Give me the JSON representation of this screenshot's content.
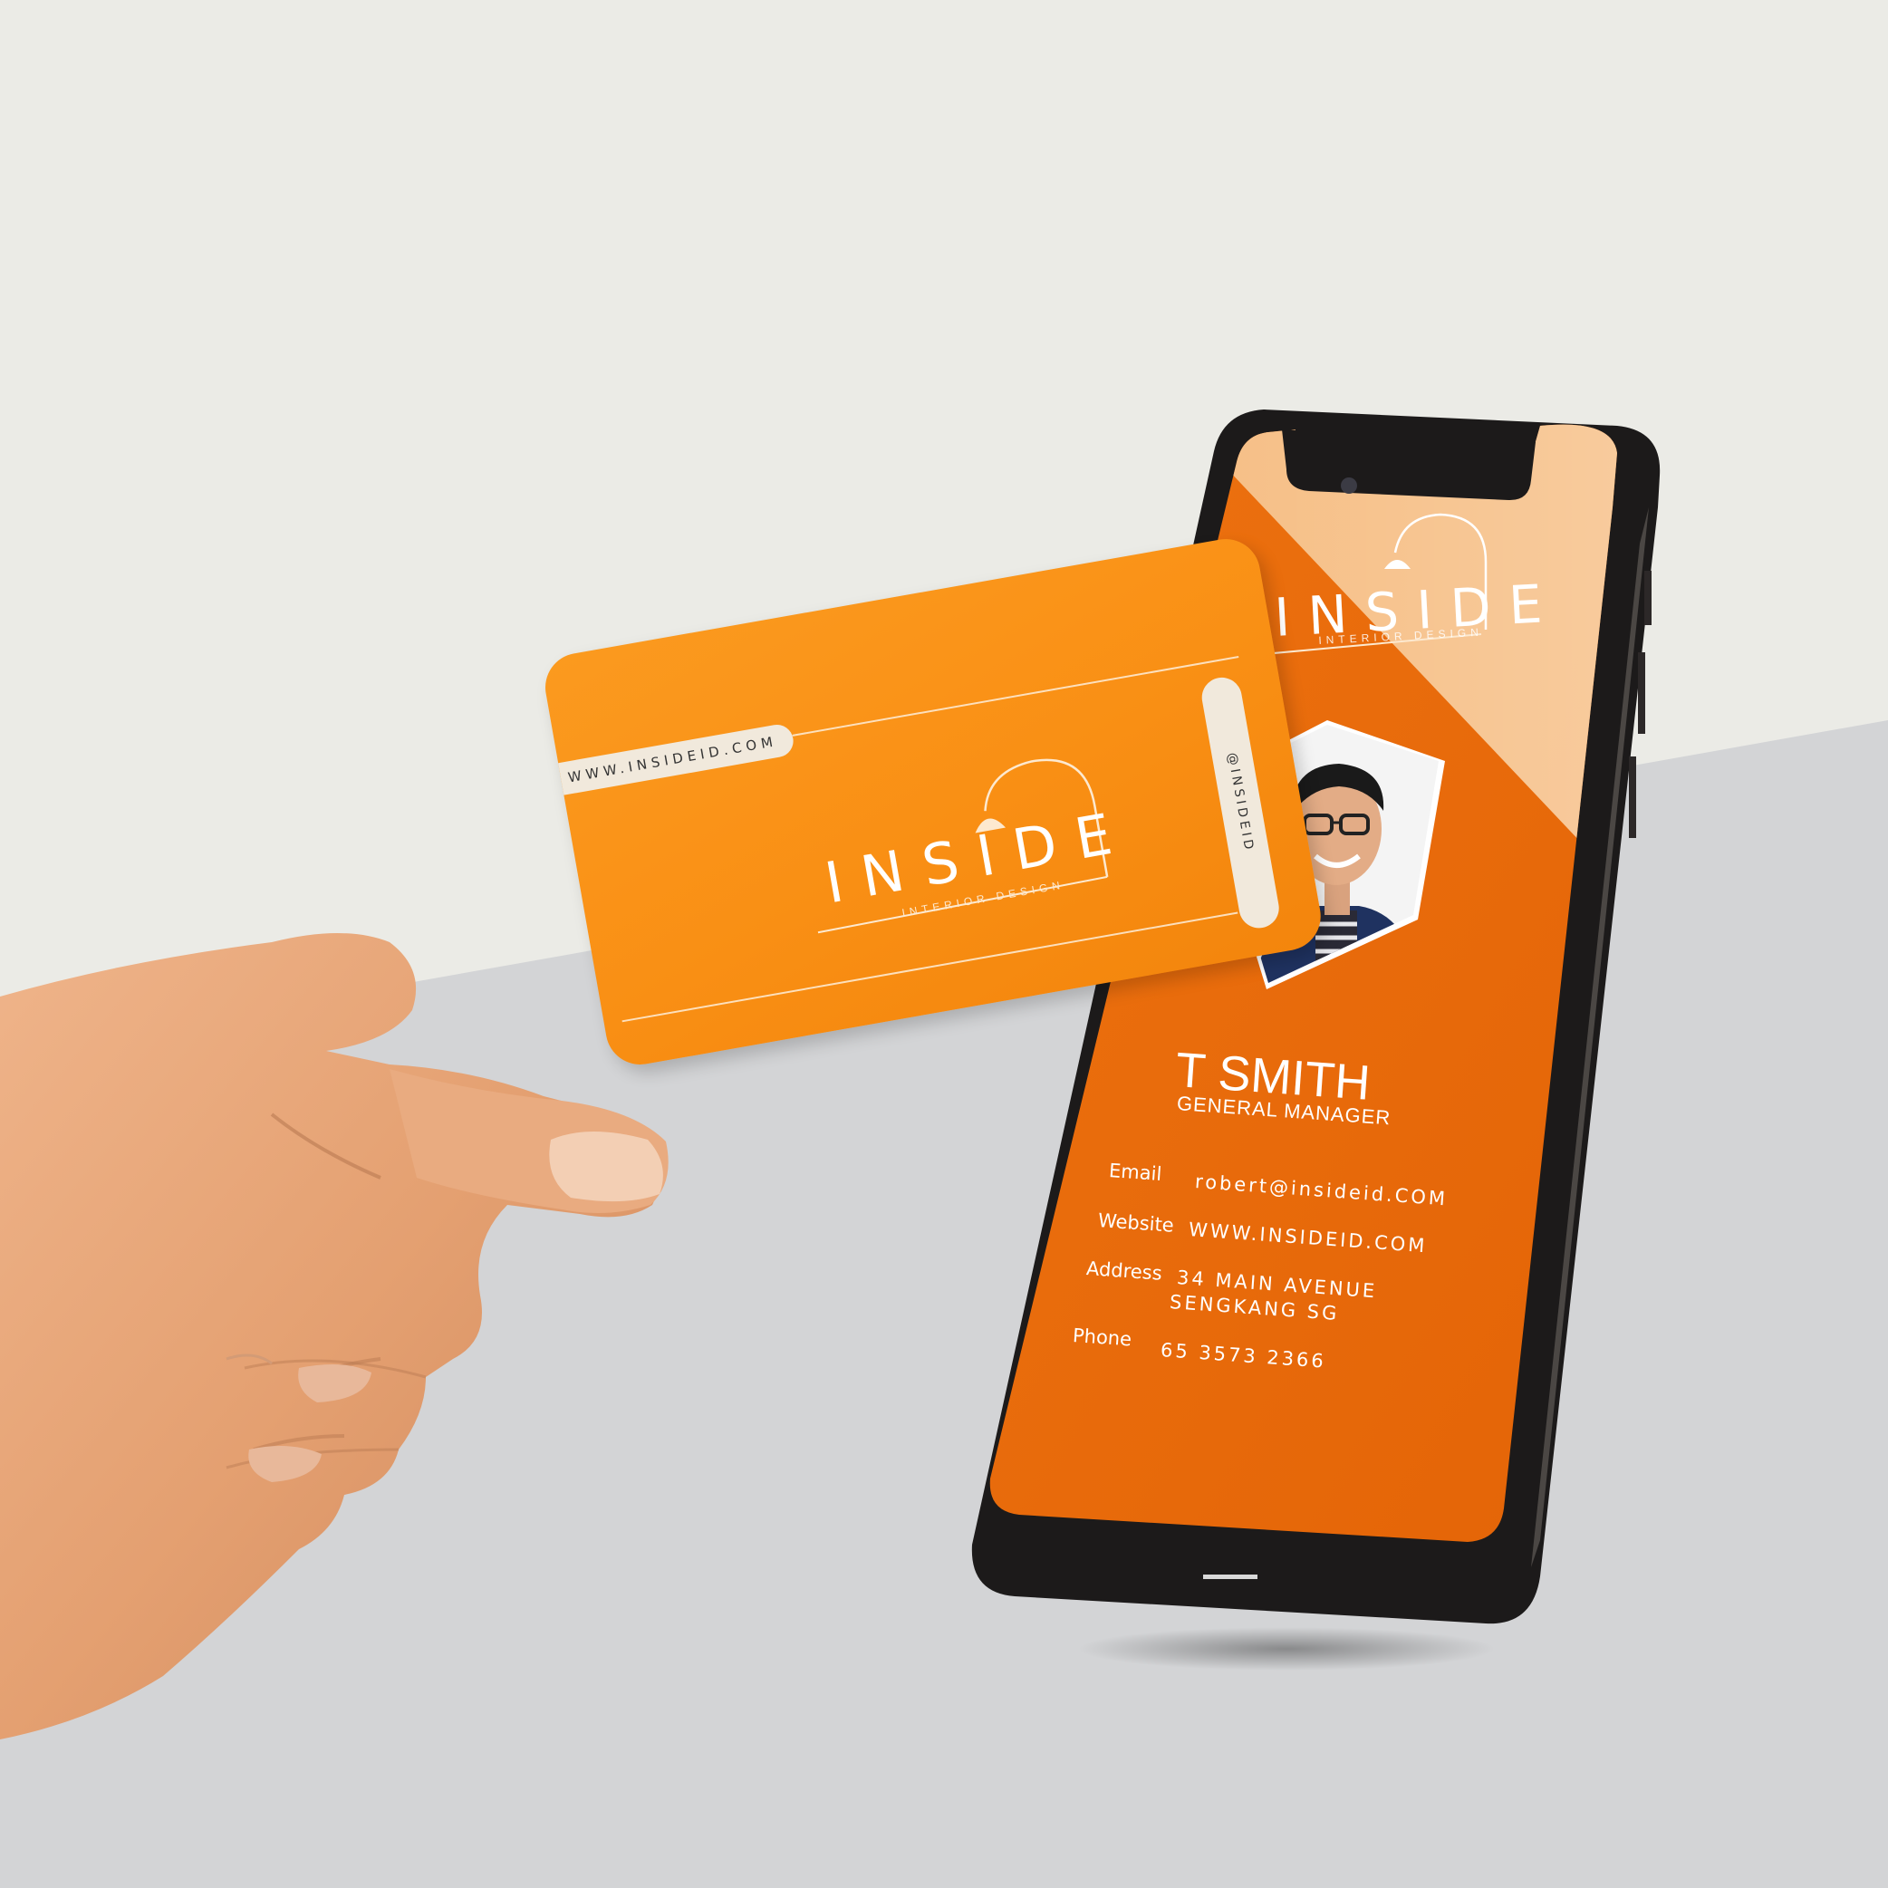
{
  "card": {
    "website_tab": "WWW.INSIDEID.COM",
    "instagram_tab": "@INSIDEID",
    "brand": "INSIDE",
    "brand_sub": "INTERIOR DESIGN"
  },
  "phone": {
    "brand": "INSIDE",
    "brand_sub": "INTERIOR DESIGN",
    "name_visible": "T SMITH",
    "job_title": "GENERAL MANAGER",
    "contacts": [
      {
        "label": "Email",
        "value": "robert@insideid.COM"
      },
      {
        "label": "Website",
        "value": "WWW.INSIDEID.COM"
      },
      {
        "label": "Address",
        "value": "34 MAIN AVENUE",
        "value2": "SENGKANG SG"
      },
      {
        "label": "Phone",
        "value": "65 3573 2366"
      }
    ]
  },
  "colors": {
    "card_orange": "#f98f14",
    "screen_orange": "#e8680a",
    "cream": "#f1e9dc",
    "background_top": "#ebebe6",
    "background_bottom": "#d3d4d6",
    "phone_frame": "#1c1a1a"
  }
}
